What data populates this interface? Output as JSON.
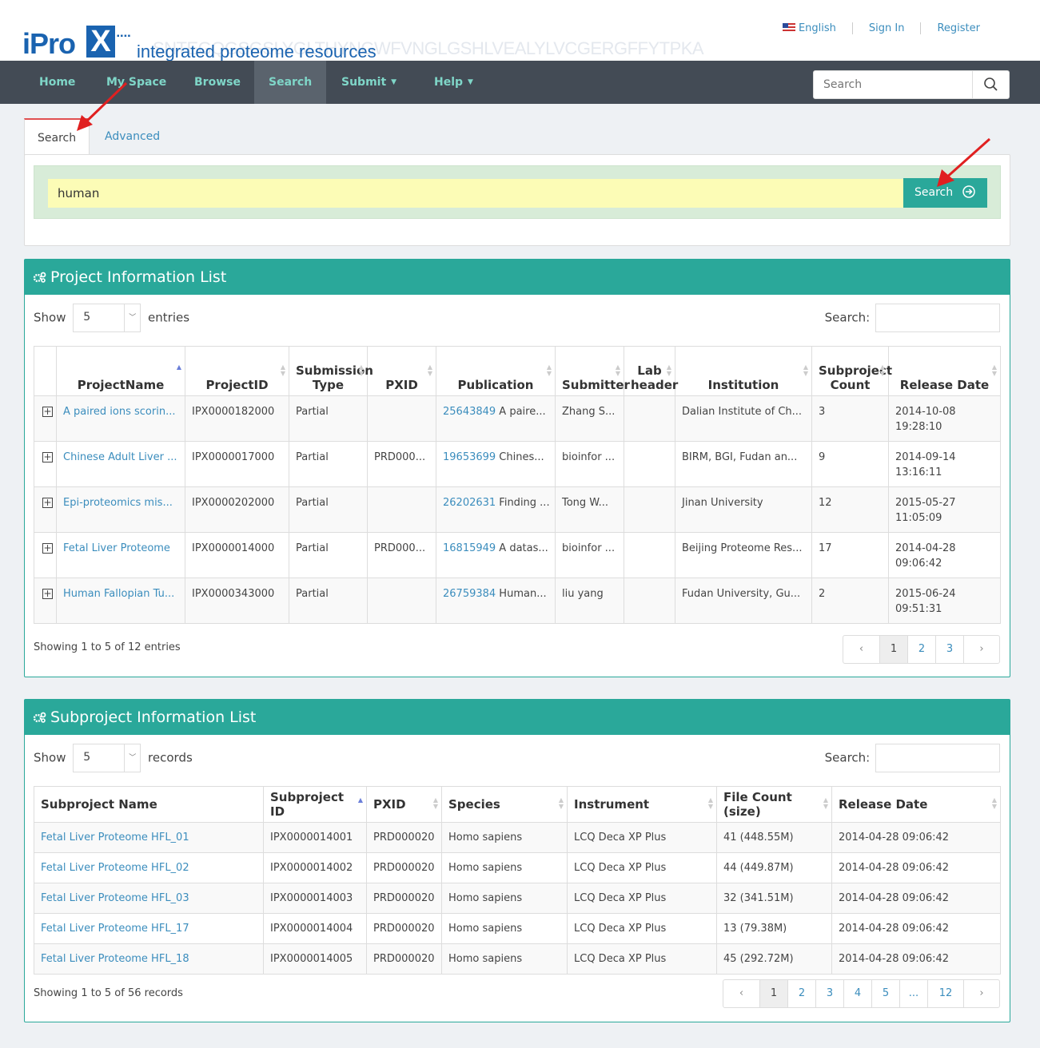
{
  "brand": {
    "name": "iPro",
    "mark": "X",
    "tagline": "integrated proteome resources",
    "watermark": "SNTEGQGSGSLYGLTHYNGWFVNGLGSHLVEALYLVCGERGFFYTPKA"
  },
  "top_links": {
    "language": "English",
    "sign_in": "Sign In",
    "register": "Register"
  },
  "nav": {
    "items": [
      "Home",
      "My Space",
      "Browse",
      "Search",
      "Submit",
      "Help"
    ],
    "search_placeholder": "Search"
  },
  "tabs": {
    "search": "Search",
    "advanced": "Advanced Search"
  },
  "query": {
    "value": "human",
    "button": "Search"
  },
  "projects": {
    "title": "Project Information List",
    "show_label": "Show",
    "show_value": "5",
    "entries_label": "entries",
    "search_label": "Search:",
    "columns": [
      "ProjectName",
      "ProjectID",
      "Submission Type",
      "PXID",
      "Publication",
      "Submitter",
      "Lab header",
      "Institution",
      "Subproject Count",
      "Release Date"
    ],
    "rows": [
      {
        "name": "A paired ions scorin...",
        "id": "IPX0000182000",
        "type": "Partial",
        "pxid": "",
        "pmid": "25643849",
        "pub": " A paire...",
        "submitter": "Zhang S...",
        "lab": "",
        "inst": "Dalian Institute of Ch...",
        "count": "3",
        "date": "2014-10-08",
        "time": "19:28:10"
      },
      {
        "name": "Chinese Adult Liver ...",
        "id": "IPX0000017000",
        "type": "Partial",
        "pxid": "PRD000...",
        "pmid": "19653699",
        "pub": " Chines...",
        "submitter": "bioinfor ...",
        "lab": "",
        "inst": "BIRM, BGI, Fudan an...",
        "count": "9",
        "date": "2014-09-14",
        "time": "13:16:11"
      },
      {
        "name": "Epi-proteomics mis...",
        "id": "IPX0000202000",
        "type": "Partial",
        "pxid": "",
        "pmid": "26202631",
        "pub": " Finding ...",
        "submitter": "Tong W...",
        "lab": "",
        "inst": "Jinan University",
        "count": "12",
        "date": "2015-05-27",
        "time": "11:05:09"
      },
      {
        "name": "Fetal Liver Proteome",
        "id": "IPX0000014000",
        "type": "Partial",
        "pxid": "PRD000...",
        "pmid": "16815949",
        "pub": " A datas...",
        "submitter": "bioinfor ...",
        "lab": "",
        "inst": "Beijing Proteome Res...",
        "count": "17",
        "date": "2014-04-28",
        "time": "09:06:42"
      },
      {
        "name": "Human Fallopian Tu...",
        "id": "IPX0000343000",
        "type": "Partial",
        "pxid": "",
        "pmid": "26759384",
        "pub": " Human...",
        "submitter": "liu yang",
        "lab": "",
        "inst": "Fudan University, Gu...",
        "count": "2",
        "date": "2015-06-24",
        "time": "09:51:31"
      }
    ],
    "info": "Showing 1 to 5 of 12 entries",
    "pages": [
      "‹",
      "1",
      "2",
      "3",
      "›"
    ]
  },
  "subprojects": {
    "title": "Subproject Information List",
    "show_label": "Show",
    "show_value": "5",
    "records_label": "records",
    "search_label": "Search:",
    "columns": [
      "Subproject Name",
      "Subproject ID",
      "PXID",
      "Species",
      "Instrument",
      "File Count (size)",
      "Release Date"
    ],
    "rows": [
      {
        "name": "Fetal Liver Proteome HFL_01",
        "id": "IPX0000014001",
        "pxid": "PRD000020",
        "species": "Homo sapiens",
        "instrument": "LCQ Deca XP Plus",
        "files": "41 (448.55M)",
        "date": "2014-04-28 09:06:42"
      },
      {
        "name": "Fetal Liver Proteome HFL_02",
        "id": "IPX0000014002",
        "pxid": "PRD000020",
        "species": "Homo sapiens",
        "instrument": "LCQ Deca XP Plus",
        "files": "44 (449.87M)",
        "date": "2014-04-28 09:06:42"
      },
      {
        "name": "Fetal Liver Proteome HFL_03",
        "id": "IPX0000014003",
        "pxid": "PRD000020",
        "species": "Homo sapiens",
        "instrument": "LCQ Deca XP Plus",
        "files": "32 (341.51M)",
        "date": "2014-04-28 09:06:42"
      },
      {
        "name": "Fetal Liver Proteome HFL_17",
        "id": "IPX0000014004",
        "pxid": "PRD000020",
        "species": "Homo sapiens",
        "instrument": "LCQ Deca XP Plus",
        "files": "13 (79.38M)",
        "date": "2014-04-28 09:06:42"
      },
      {
        "name": "Fetal Liver Proteome HFL_18",
        "id": "IPX0000014005",
        "pxid": "PRD000020",
        "species": "Homo sapiens",
        "instrument": "LCQ Deca XP Plus",
        "files": "45 (292.72M)",
        "date": "2014-04-28 09:06:42"
      }
    ],
    "info": "Showing 1 to 5 of 56 records",
    "pages": [
      "‹",
      "1",
      "2",
      "3",
      "4",
      "5",
      "...",
      "12",
      "›"
    ]
  },
  "colors": {
    "accent": "#2aa89a",
    "nav_bg": "#434b55",
    "link": "#3b8dbd",
    "annotation_arrow": "#e02020"
  }
}
